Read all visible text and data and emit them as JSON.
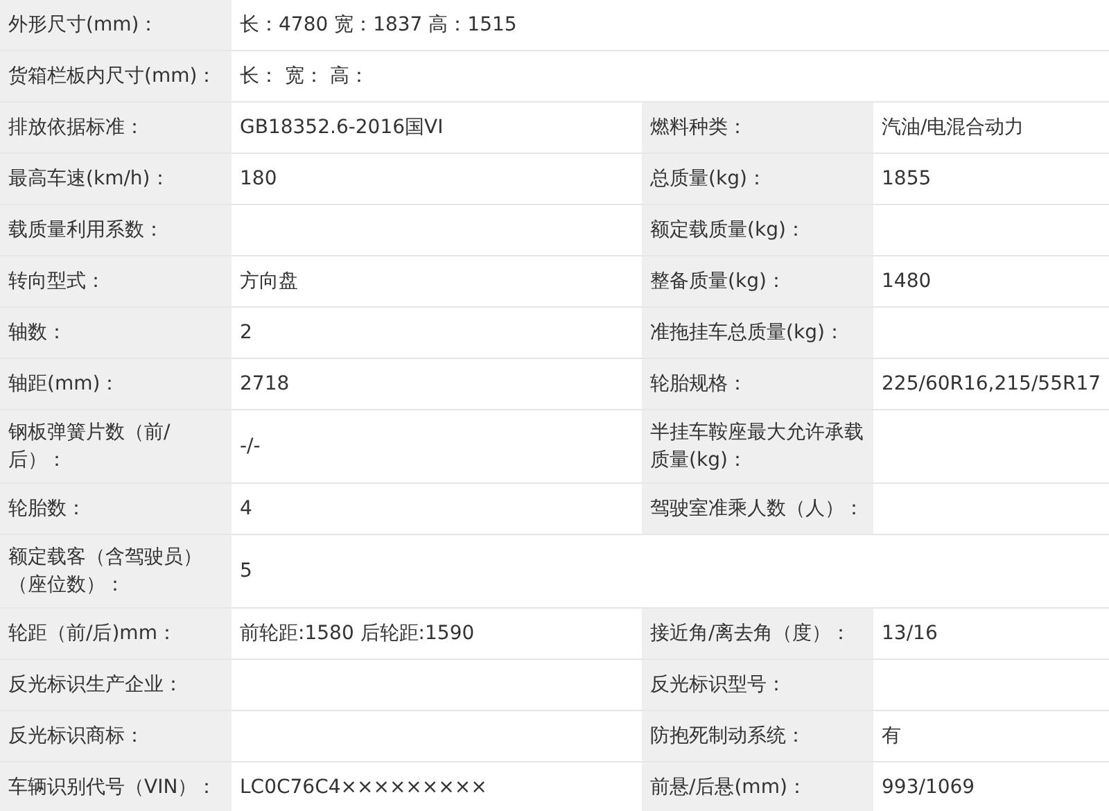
{
  "rows": [
    [
      {
        "label": "外形尺寸(mm)：",
        "value": "长：4780 宽：1837 高：1515"
      }
    ],
    [
      {
        "label": "货箱栏板内尺寸(mm)：",
        "value": "长：  宽：  高："
      }
    ],
    [
      {
        "label": "排放依据标准：",
        "value": "GB18352.6-2016国VI"
      },
      {
        "label": "燃料种类：",
        "value": "汽油/电混合动力"
      }
    ],
    [
      {
        "label": "最高车速(km/h)：",
        "value": "180"
      },
      {
        "label": "总质量(kg)：",
        "value": "1855"
      }
    ],
    [
      {
        "label": "载质量利用系数："
      },
      {
        "label": "额定载质量(kg)："
      }
    ],
    [
      {
        "label": "转向型式：",
        "value": "方向盘"
      },
      {
        "label": "整备质量(kg)：",
        "value": "1480"
      }
    ],
    [
      {
        "label": "轴数：",
        "value": "2"
      },
      {
        "label": "准拖挂车总质量(kg)："
      }
    ],
    [
      {
        "label": "轴距(mm)：",
        "value": "2718"
      },
      {
        "label": "轮胎规格：",
        "value": "225/60R16,215/55R17"
      }
    ],
    [
      {
        "label": "钢板弹簧片数（前/后）：",
        "value": "-/-"
      },
      {
        "label": "半挂车鞍座最大允许承载质量(kg)："
      }
    ],
    [
      {
        "label": "轮胎数：",
        "value": "4"
      },
      {
        "label": "驾驶室准乘人数（人）："
      }
    ],
    [
      {
        "label": "额定载客（含驾驶员）（座位数）：",
        "value": "5"
      }
    ],
    [
      {
        "label": "轮距（前/后)mm：",
        "value": "前轮距:1580 后轮距:1590"
      },
      {
        "label": "接近角/离去角（度）：",
        "value": "13/16"
      }
    ],
    [
      {
        "label": "反光标识生产企业："
      },
      {
        "label": "反光标识型号："
      }
    ],
    [
      {
        "label": "反光标识商标："
      },
      {
        "label": "防抱死制动系统：",
        "value": "有"
      }
    ],
    [
      {
        "label": "车辆识别代号（VIN）：",
        "value": "LC0C76C4×××××××××"
      },
      {
        "label": "前悬/后悬(mm)：",
        "value": "993/1069"
      }
    ]
  ]
}
